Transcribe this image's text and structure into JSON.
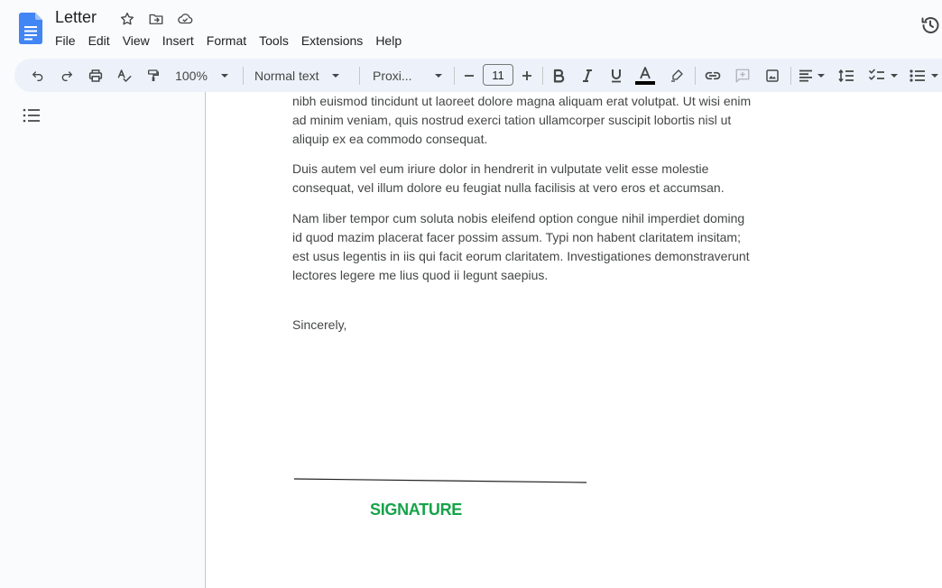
{
  "document": {
    "title": "Letter"
  },
  "menubar": {
    "items": [
      "File",
      "Edit",
      "View",
      "Insert",
      "Format",
      "Tools",
      "Extensions",
      "Help"
    ]
  },
  "toolbar": {
    "zoom": "100%",
    "style": "Normal text",
    "font": "Proxi...",
    "font_size": "11"
  },
  "content": {
    "paragraphs": [
      "nibh euismod tincidunt ut laoreet dolore magna aliquam erat volutpat. Ut wisi enim ad minim veniam, quis nostrud exerci tation ullamcorper suscipit lobortis nisl ut aliquip ex ea commodo consequat.",
      "Duis autem vel eum iriure dolor in hendrerit in vulputate velit esse molestie consequat, vel illum dolore eu feugiat nulla facilisis at vero eros et accumsan.",
      "Nam liber tempor cum soluta nobis eleifend option congue nihil imperdiet doming id quod mazim placerat facer possim assum. Typi non habent claritatem insitam; est usus legentis in iis qui facit eorum claritatem. Investigationes demonstraverunt lectores legere me lius quod ii legunt saepius.",
      "Sincerely,"
    ],
    "signature_label": "SIGNATURE"
  },
  "colors": {
    "app_background": "#f9fbfd",
    "toolbar_background": "#edf2fa",
    "docs_blue": "#4285f4",
    "signature_green": "#16a34a",
    "text_color_bar": "#000000"
  },
  "icons": [
    "docs-logo-icon",
    "star-icon",
    "move-folder-icon",
    "cloud-saved-icon",
    "history-icon",
    "undo-icon",
    "redo-icon",
    "print-icon",
    "spellcheck-icon",
    "paint-format-icon",
    "chevron-down-icon",
    "minus-icon",
    "plus-icon",
    "bold-icon",
    "italic-icon",
    "underline-icon",
    "text-color-icon",
    "highlight-icon",
    "link-icon",
    "comment-icon",
    "image-icon",
    "align-left-icon",
    "line-spacing-icon",
    "checklist-icon",
    "bulleted-list-icon",
    "outline-icon"
  ]
}
